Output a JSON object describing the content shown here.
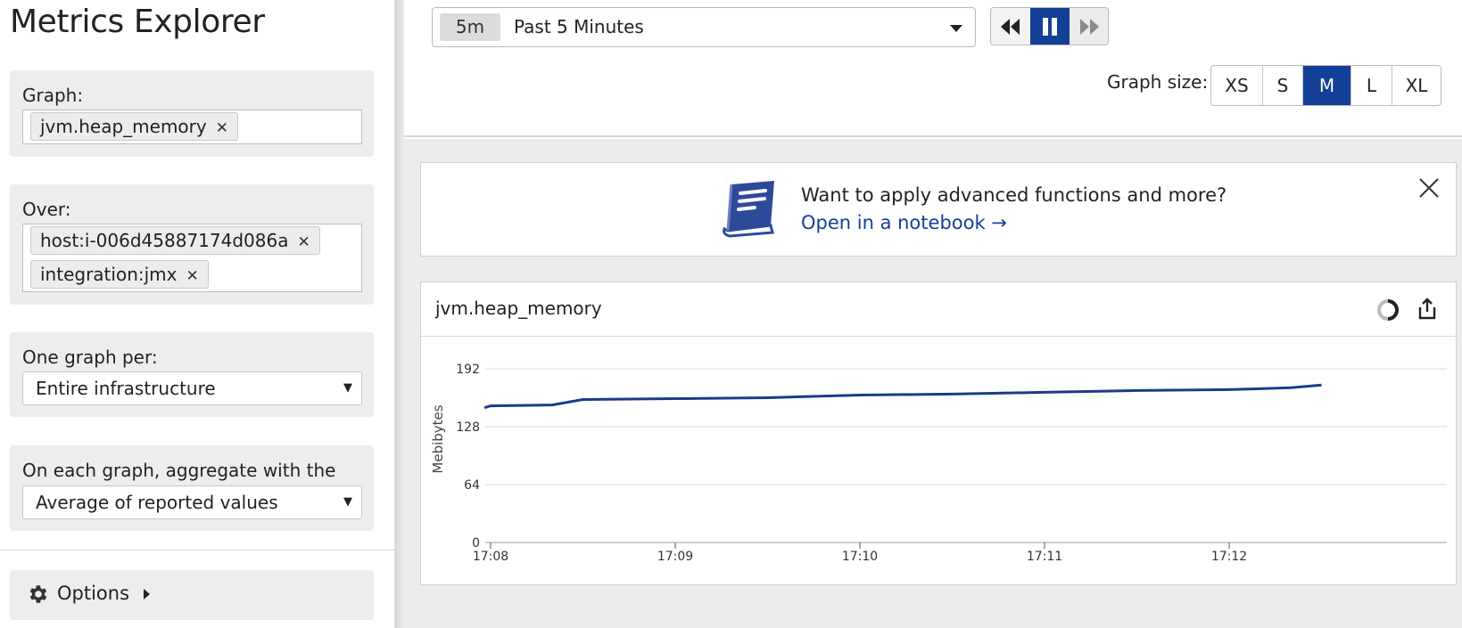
{
  "app_title": "Metrics Explorer",
  "sidebar": {
    "graph": {
      "label": "Graph:",
      "tags": [
        "jvm.heap_memory"
      ]
    },
    "over": {
      "label": "Over:",
      "tags": [
        "host:i-006d45887174d086a",
        "integration:jmx"
      ]
    },
    "one_graph_per": {
      "label": "One graph per:",
      "value": "Entire infrastructure"
    },
    "aggregate": {
      "label": "On each graph, aggregate with the",
      "value": "Average of reported values"
    },
    "options": {
      "label": "Options",
      "icon": "gear-icon"
    }
  },
  "toolbar": {
    "time_badge": "5m",
    "time_label": "Past 5 Minutes",
    "playback": {
      "rewind_icon": "rewind-icon",
      "pause_icon": "pause-icon",
      "forward_icon": "fast-forward-icon",
      "active": "pause"
    },
    "graph_size_label": "Graph size:",
    "graph_sizes": [
      "XS",
      "S",
      "M",
      "L",
      "XL"
    ],
    "graph_size_selected": "M"
  },
  "banner": {
    "text": "Want to apply advanced functions and more?",
    "link": "Open in a notebook →",
    "icon": "notebook-icon",
    "close_icon": "close-icon"
  },
  "graph": {
    "title": "jvm.heap_memory",
    "loading_icon": "loading-icon",
    "export_icon": "export-icon"
  },
  "colors": {
    "accent": "#143f96",
    "line": "#1b3a8a",
    "panel_bg": "#ededed",
    "main_bg": "#ececec"
  },
  "chart_data": {
    "type": "line",
    "title": "",
    "xlabel": "",
    "ylabel": "Mebibytes",
    "x_ticks": [
      "17:08",
      "17:09",
      "17:10",
      "17:11",
      "17:12"
    ],
    "y_ticks": [
      0,
      64,
      128,
      192
    ],
    "ylim": [
      0,
      192
    ],
    "grid": true,
    "series": [
      {
        "color": "#1b3a8a",
        "points": [
          [
            "17:07:58",
            149
          ],
          [
            "17:08:00",
            151
          ],
          [
            "17:08:20",
            152
          ],
          [
            "17:08:30",
            158
          ],
          [
            "17:09:00",
            159
          ],
          [
            "17:09:30",
            160
          ],
          [
            "17:10:00",
            163
          ],
          [
            "17:10:30",
            164
          ],
          [
            "17:11:00",
            166
          ],
          [
            "17:11:30",
            168
          ],
          [
            "17:12:00",
            169
          ],
          [
            "17:12:20",
            171
          ],
          [
            "17:12:30",
            174
          ]
        ]
      }
    ]
  }
}
